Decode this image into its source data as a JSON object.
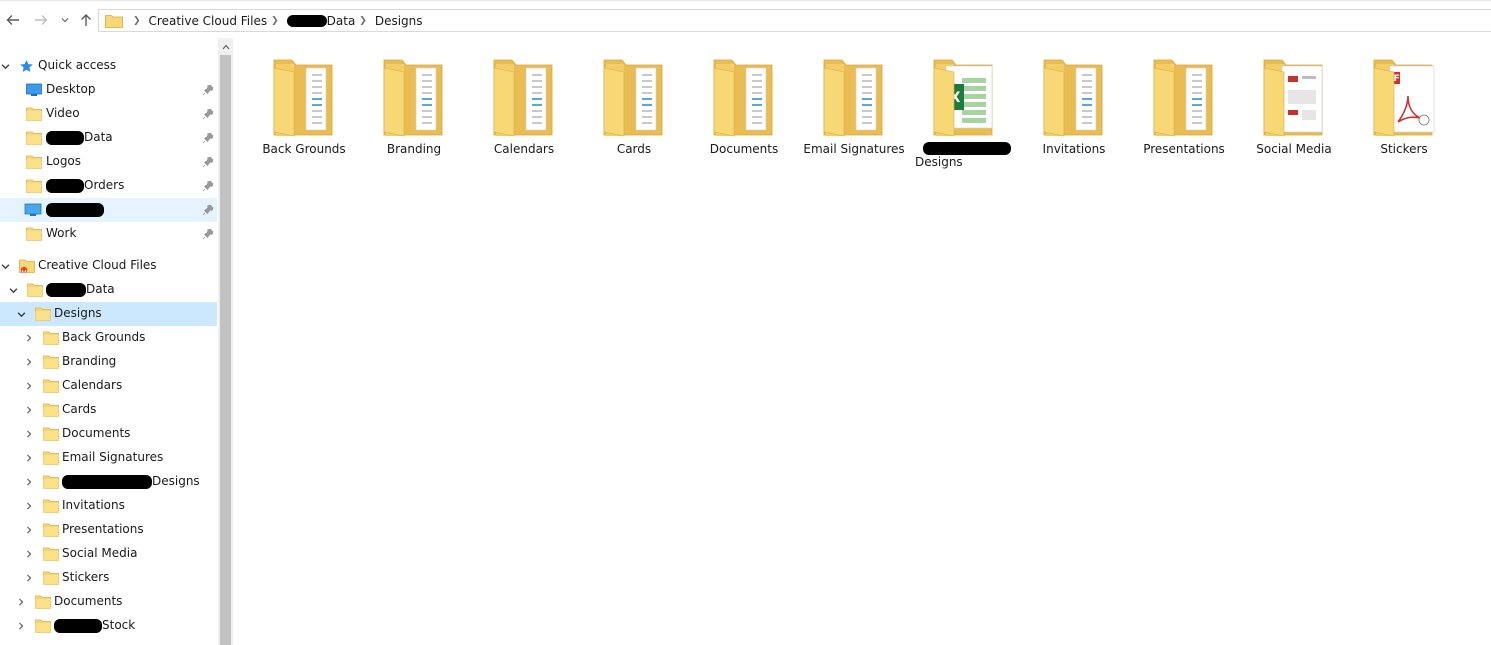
{
  "breadcrumb": {
    "segments": [
      "Creative Cloud Files",
      "Data",
      "Designs"
    ]
  },
  "quick_access": {
    "title": "Quick access",
    "items": [
      {
        "label": "Desktop",
        "icon": "desktop-icon"
      },
      {
        "label": "Video",
        "icon": "folder-icon"
      },
      {
        "label": "Data",
        "icon": "folder-icon"
      },
      {
        "label": "Logos",
        "icon": "folder-icon"
      },
      {
        "label": "Orders",
        "icon": "folder-icon"
      },
      {
        "label": "",
        "icon": "computer-icon"
      },
      {
        "label": "Work",
        "icon": "folder-icon"
      }
    ]
  },
  "tree": {
    "root_label": "Creative Cloud Files",
    "data_label": "Data",
    "designs_label": "Designs",
    "children": [
      "Back Grounds",
      "Branding",
      "Calendars",
      "Cards",
      "Documents",
      "Email Signatures",
      "Designs",
      "Invitations",
      "Presentations",
      "Social Media",
      "Stickers"
    ],
    "after": [
      "Documents",
      "Stock"
    ]
  },
  "content": {
    "items": [
      {
        "label": "Back Grounds",
        "variant": "generic"
      },
      {
        "label": "Branding",
        "variant": "generic"
      },
      {
        "label": "Calendars",
        "variant": "generic"
      },
      {
        "label": "Cards",
        "variant": "generic"
      },
      {
        "label": "Documents",
        "variant": "generic"
      },
      {
        "label": "Email Signatures",
        "variant": "generic"
      },
      {
        "label": "Designs",
        "variant": "excel"
      },
      {
        "label": "Invitations",
        "variant": "generic"
      },
      {
        "label": "Presentations",
        "variant": "generic"
      },
      {
        "label": "Social Media",
        "variant": "social"
      },
      {
        "label": "Stickers",
        "variant": "pdf"
      }
    ]
  },
  "colors": {
    "selection": "#cce8ff",
    "hover": "#e5f3ff",
    "folder": "#f8d775",
    "folder_dark": "#e6b94a"
  }
}
